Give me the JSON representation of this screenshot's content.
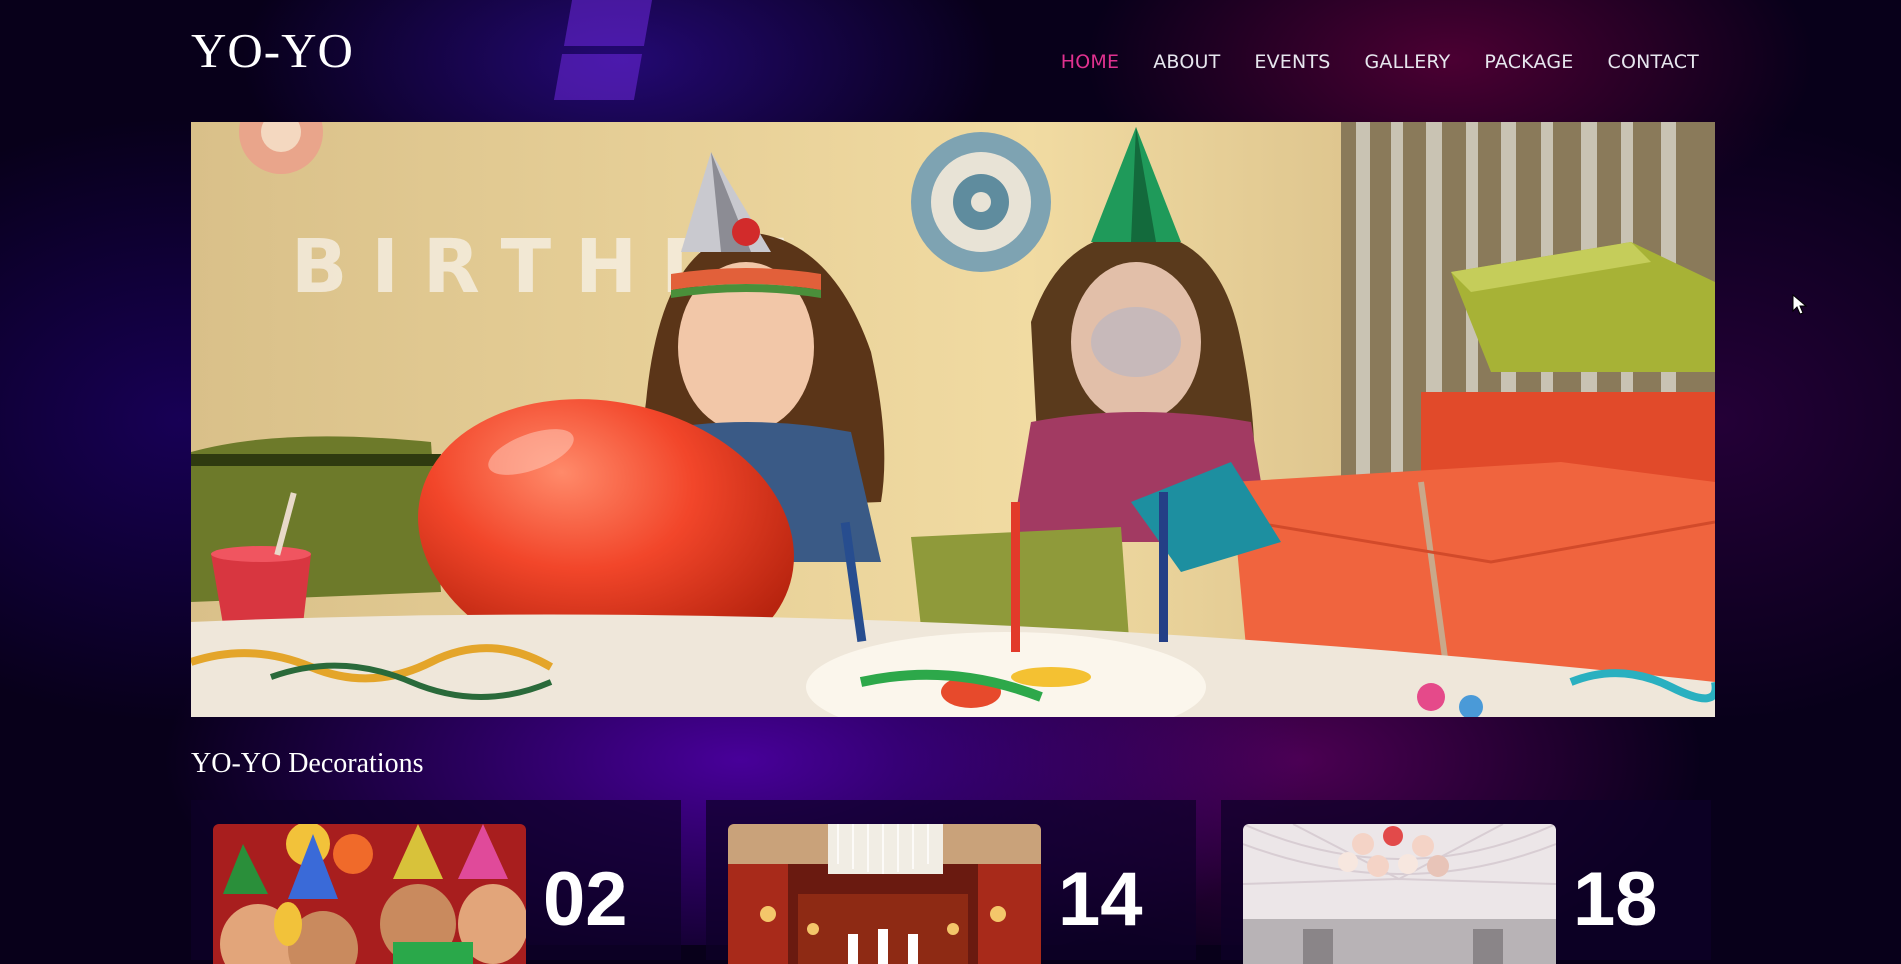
{
  "site": {
    "logo": "YO-YO"
  },
  "nav": {
    "items": [
      {
        "label": "HOME",
        "active": true
      },
      {
        "label": "ABOUT"
      },
      {
        "label": "EVENTS"
      },
      {
        "label": "GALLERY"
      },
      {
        "label": "PACKAGE"
      },
      {
        "label": "CONTACT"
      }
    ]
  },
  "hero": {
    "banner_text": "BIRTHDA"
  },
  "section": {
    "title": "YO-YO Decorations"
  },
  "cards": [
    {
      "number": "02"
    },
    {
      "number": "14"
    },
    {
      "number": "18"
    }
  ],
  "colors": {
    "background": "#08001a",
    "nav_active": "#e0318f",
    "nav_text": "#e6e6ee",
    "card_bg": "#0e0028"
  }
}
